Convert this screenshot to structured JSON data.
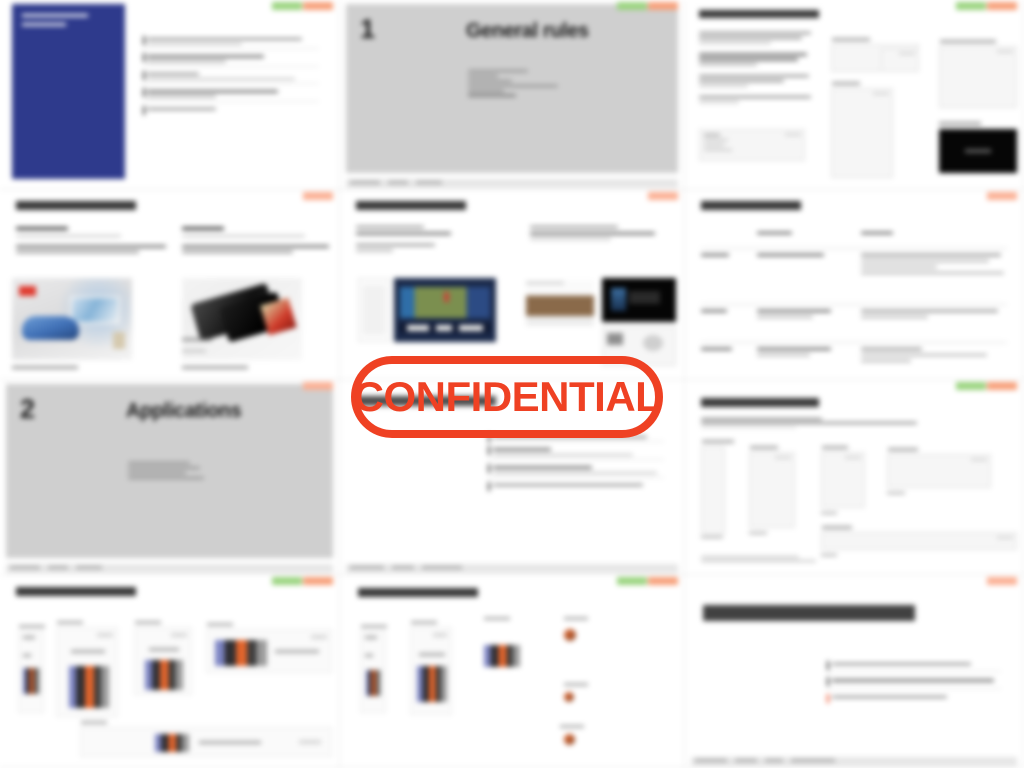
{
  "document": {
    "kind": "slide-thumbnail-grid",
    "rows": 4,
    "columns": 3,
    "total_slides": 12
  },
  "overlay": {
    "stamp_label": "CONFIDENTIAL",
    "stamp_color": "#ef4123",
    "stamp_shape": "rounded-rectangle-outline"
  },
  "colors": {
    "cover_panel": "#2e3a8c",
    "divider_background": "#cfcfcf",
    "badge_green": "#9ad47f",
    "badge_orange": "#f7a07a",
    "accent_orange": "#ee4b24",
    "page_background": "#ffffff"
  },
  "slides": [
    {
      "index": 1,
      "type": "cover",
      "title": "advertising\nprinciples",
      "badges": [
        "approved",
        "restricted"
      ],
      "body_lines": 5,
      "footer": ""
    },
    {
      "index": 2,
      "type": "section-divider",
      "number": "1",
      "title": "General rules",
      "badges": [
        "approved",
        "restricted"
      ],
      "contents": [
        "Logo usage",
        "Colour",
        "Typography",
        "Photography",
        "Imagery",
        "Templates",
        "Tone of voice"
      ],
      "footer": "Brand guidelines   |   2024   |   Page 04"
    },
    {
      "index": 3,
      "type": "content-wireframes",
      "title": "advertising templates",
      "badges": [
        "approved",
        "restricted"
      ],
      "body_paragraphs": 4,
      "wireframe_boxes": 5,
      "has_black_panel": true,
      "footer": ""
    },
    {
      "index": 4,
      "type": "content-photos",
      "title": "Product logo placement",
      "badges": [
        "restricted"
      ],
      "columns": [
        {
          "heading": "Clear space",
          "lines": 2
        },
        {
          "heading": "Minimum size",
          "lines": 2
        }
      ],
      "photos": [
        "living-room-with-car-and-tv",
        "dark-devices-product-shot"
      ],
      "captions": [
        "Do use the correct ratio",
        "Do not distort the logo"
      ],
      "footer": ""
    },
    {
      "index": 5,
      "type": "content-photos",
      "title": "Service logo placement",
      "badges": [
        "restricted"
      ],
      "columns": [
        {
          "heading": "Service placement",
          "lines": 3
        },
        {
          "heading": "Service placement rules",
          "lines": 3
        }
      ],
      "photos": [
        "phone-mockup",
        "tv-interface-screenshot",
        "sepia-banner",
        "black-app-panel"
      ],
      "footer": ""
    },
    {
      "index": 6,
      "type": "table",
      "title": "Setting our typeface",
      "badges": [
        "restricted"
      ],
      "table": {
        "columns": [
          "Usage",
          "Weight",
          "Guideline"
        ],
        "rows": [
          {
            "usage": "Headline",
            "weight": "Bold / Medium",
            "guideline_lines": 4
          },
          {
            "usage": "Body copy",
            "weight": "Regular / Light",
            "guideline_lines": 2
          },
          {
            "usage": "Captions",
            "weight": "Regular / Light",
            "guideline_lines": 3
          }
        ]
      },
      "footer": ""
    },
    {
      "index": 7,
      "type": "section-divider",
      "number": "2",
      "title": "Applications",
      "badges": [
        "restricted"
      ],
      "contents": [
        "Digital display",
        "Video",
        "Social",
        "Print"
      ],
      "footer": "Brand guidelines   |   2024   |   Page 28"
    },
    {
      "index": 8,
      "type": "content-bullets",
      "title": "Digital display advertising",
      "badges": [],
      "bullets": [
        "Use approved templates for all display formats",
        "Logo must appear in the top-left safe area",
        "Maintain minimum legible type sizes at all breakpoints",
        "Animation must not exceed the stated frame limit"
      ],
      "footer": "Brand guidelines   |   2024   |   Applications"
    },
    {
      "index": 9,
      "type": "content-wireframes",
      "title": "Template - Digital display",
      "badges": [
        "approved",
        "restricted"
      ],
      "intro_lines": 3,
      "wireframe_boxes": 6,
      "size_labels": [
        "160 x 600",
        "300 x 250",
        "300 x 600",
        "336 x 280",
        "728 x 90",
        "970 x 250"
      ],
      "footnote_lines": 2,
      "footer": ""
    },
    {
      "index": 10,
      "type": "content-examples",
      "title": "Digital display examples",
      "badges": [
        "approved",
        "restricted"
      ],
      "ad_units": 5,
      "footer": ""
    },
    {
      "index": 11,
      "type": "content-examples",
      "title": "Digital display examples",
      "badges": [
        "approved",
        "restricted"
      ],
      "ad_units": 6,
      "footer": ""
    },
    {
      "index": 12,
      "type": "content-bullets",
      "title": "Video advertising/content",
      "badges": [
        "restricted"
      ],
      "bullets": [
        "Use approved end-frames on all video content",
        "Supers must appear in the safe zone on every cut",
        "Logo stings must not be recoloured"
      ],
      "footer": "Brand guidelines   |   2024   |   Applications"
    }
  ]
}
